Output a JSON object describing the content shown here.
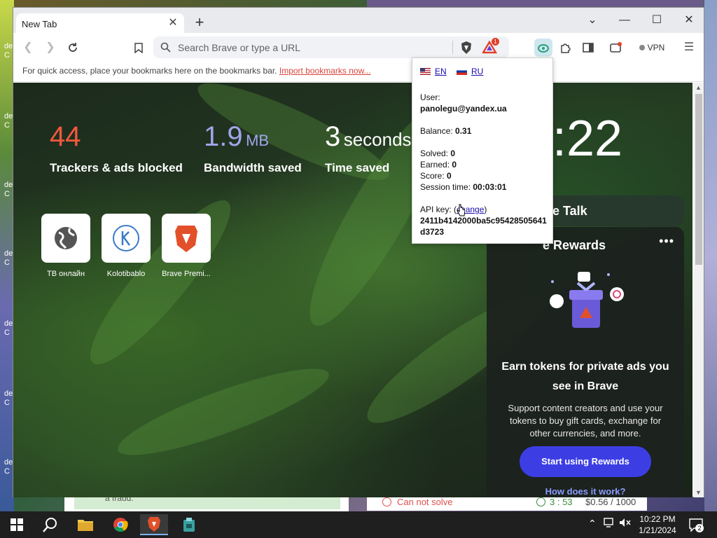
{
  "browser": {
    "tab_title": "New Tab",
    "address_placeholder": "Search Brave or type a URL",
    "bookmarks_prompt": "For quick access, place your bookmarks here on the bookmarks bar.",
    "import_link": "Import bookmarks now...",
    "vpn_label": "VPN",
    "notification_count": "1"
  },
  "stats": {
    "trackers_value": "44",
    "trackers_label": "Trackers & ads blocked",
    "bandwidth_value": "1.9",
    "bandwidth_unit": "MB",
    "bandwidth_label": "Bandwidth saved",
    "time_value": "3",
    "time_unit": "seconds",
    "time_label": "Time saved",
    "clock": ":22"
  },
  "tiles": [
    {
      "label": "ТВ онлайн"
    },
    {
      "label": "Kolotibablo"
    },
    {
      "label": "Brave Premi..."
    }
  ],
  "widgets": {
    "talk_title": "e Talk",
    "rewards_title": "e Rewards",
    "rewards_heading": "Earn tokens for private ads you see in Brave",
    "rewards_desc": "Support content creators and use your tokens to buy gift cards, exchange for other currencies, and more.",
    "rewards_button": "Start using Rewards",
    "rewards_link": "How does it work?"
  },
  "popup": {
    "lang_en": "EN",
    "lang_ru": "RU",
    "user_label": "User:",
    "user_value": "panolegu@yandex.ua",
    "balance_label": "Balance:",
    "balance_value": "0.31",
    "solved_label": "Solved:",
    "solved_value": "0",
    "earned_label": "Earned:",
    "earned_value": "0",
    "score_label": "Score:",
    "score_value": "0",
    "session_label": "Session time:",
    "session_value": "00:03:01",
    "api_label": "API key:",
    "api_change": "change",
    "api_value": "2411b4142000ba5c95428505641d3723"
  },
  "under_window": {
    "left_text": "a fraud.",
    "cannot_solve": "Can not solve",
    "timer": "3 : 53",
    "price": "$0.56 / 1000"
  },
  "desktop_icons": [
    "de",
    "C",
    "de",
    "C",
    "de",
    "C",
    "de",
    "C",
    "de",
    "C",
    "de",
    "C",
    "de",
    "C"
  ],
  "taskbar": {
    "time": "10:22 PM",
    "date": "1/21/2024",
    "notif_count": "2"
  },
  "colors": {
    "trackers": "#f0593c",
    "bandwidth": "#a0a5eb",
    "rewards_button": "#3c3ee4",
    "link_red": "#d9453e"
  }
}
